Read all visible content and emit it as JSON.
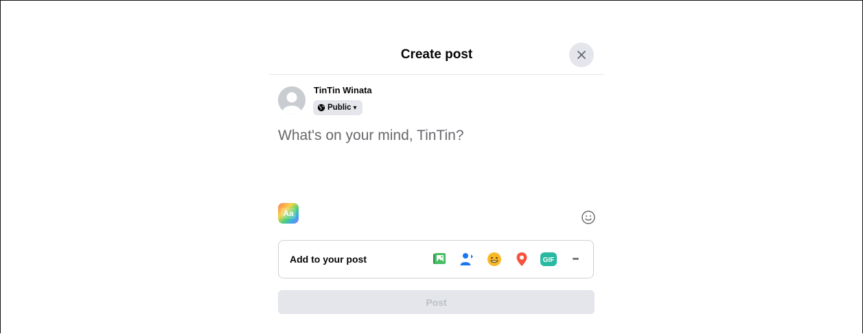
{
  "dialog": {
    "title": "Create post",
    "close_icon": "close-icon"
  },
  "user": {
    "name": "TinTin Winata",
    "audience": "Public",
    "audience_icon": "globe-icon",
    "audience_caret": "▾"
  },
  "composer": {
    "placeholder": "What's on your mind, TinTin?",
    "value": ""
  },
  "formatting": {
    "background_button_label": "Aa",
    "emoji_icon": "smiley-icon"
  },
  "add_to_post": {
    "label": "Add to your post",
    "tools": [
      {
        "name": "photo-video",
        "icon": "photo-icon",
        "color": "#45bd62"
      },
      {
        "name": "tag-people",
        "icon": "tag-people-icon",
        "color": "#1877f2"
      },
      {
        "name": "feeling-activity",
        "icon": "feeling-icon",
        "color": "#f7b928"
      },
      {
        "name": "check-in",
        "icon": "location-pin-icon",
        "color": "#f5533d"
      },
      {
        "name": "gif",
        "icon": "gif-icon",
        "label": "GIF",
        "color": "#28b9a1"
      },
      {
        "name": "more",
        "icon": "more-icon",
        "label": "•••"
      }
    ]
  },
  "post_button": {
    "label": "Post",
    "enabled": false
  },
  "colors": {
    "disabled_button_bg": "#e4e6eb",
    "disabled_button_text": "#bcc0c4",
    "secondary_text": "#65676b"
  }
}
